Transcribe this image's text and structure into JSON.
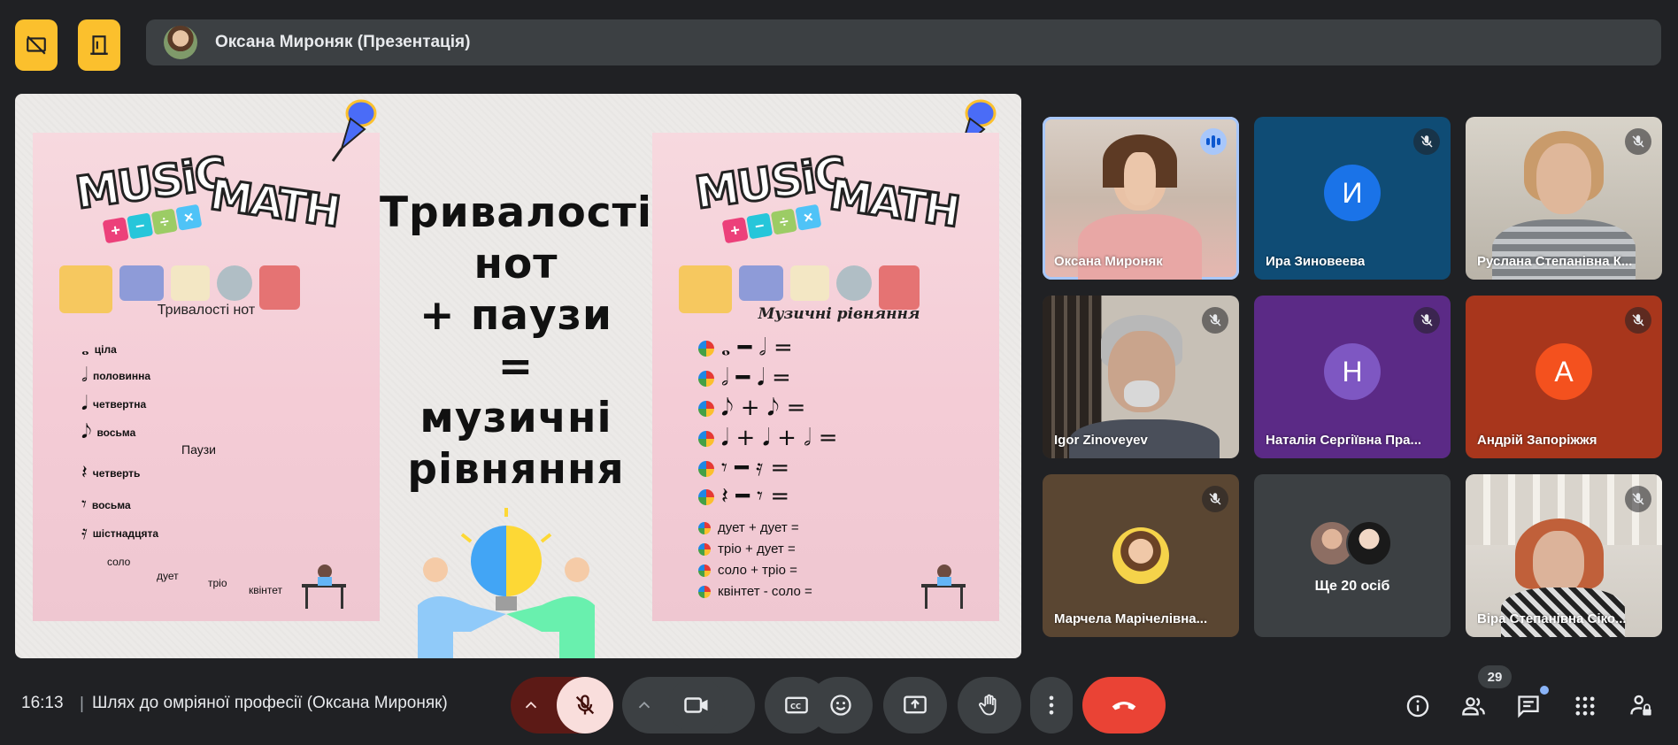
{
  "presenter": {
    "name": "Оксана Мироняк (Презентація)"
  },
  "slide": {
    "left_poster": {
      "word1": "MUSiC",
      "word2": "MATH",
      "title": "Тривалості нот",
      "notes": [
        "ціла",
        "половинна",
        "четвертна",
        "восьма"
      ],
      "pauses_label": "Паузи",
      "rests": [
        "четверть",
        "восьма",
        "шістнадцята"
      ],
      "ensembles": [
        "соло",
        "дует",
        "тріо",
        "квінтет"
      ]
    },
    "center_title": [
      "Тривалості",
      "нот",
      "+ паузи",
      "=",
      "музичні",
      "рівняння"
    ],
    "right_poster": {
      "word1": "MUSiC",
      "word2": "MATH",
      "title": "Музичні рівняння",
      "equations": [
        "𝅝 ━ 𝅗𝅥 =",
        "𝅗𝅥 ━ 𝅘𝅥 =",
        "𝅘𝅥𝅮 + 𝅘𝅥𝅮 =",
        "𝅘𝅥 + 𝅘𝅥 + 𝅗𝅥 =",
        "𝄾 ━ 𝄿 =",
        "𝄽 ━ 𝄾 ="
      ],
      "word_equations": [
        "дует + дует =",
        "тріо + дует =",
        "соло + тріо =",
        "квінтет - соло ="
      ]
    }
  },
  "participants": [
    {
      "name": "Оксана Мироняк",
      "kind": "video",
      "speaking": true
    },
    {
      "name": "Ира Зиновеева",
      "kind": "letter",
      "letter": "И",
      "avatar_color": "#1a73e8",
      "bg": "#0f4c75",
      "muted": true
    },
    {
      "name": "Руслана Степанівна К...",
      "kind": "video",
      "muted": true
    },
    {
      "name": "Igor Zinoveyev",
      "kind": "video",
      "muted": true
    },
    {
      "name": "Наталія Сергіївна Пра...",
      "kind": "letter",
      "letter": "Н",
      "avatar_color": "#7e57c2",
      "bg": "#5b2a86",
      "muted": true
    },
    {
      "name": "Андрій Запоріжжя",
      "kind": "letter",
      "letter": "А",
      "avatar_color": "#f4511e",
      "bg": "#a8361c",
      "muted": true
    },
    {
      "name": "Марчела Марічелівна...",
      "kind": "photo",
      "muted": true
    },
    {
      "name": "Ще 20 осіб",
      "kind": "more"
    },
    {
      "name": "Віра Степанівна Сіко...",
      "kind": "video",
      "muted": true
    }
  ],
  "bottom": {
    "time": "16:13",
    "separator": "|",
    "meeting_title": "Шлях до омріяної професії (Оксана Мироняк)",
    "people_count": "29"
  },
  "colors": {
    "background": "#202124",
    "accent_yellow": "#fbc02d",
    "hangup_red": "#ea4335",
    "mic_off_bg": "#f9dedc"
  },
  "icons": [
    "no-presentation-icon",
    "door-exit-icon",
    "mic-off-icon",
    "chevron-up-icon",
    "camera-icon",
    "captions-icon",
    "emoji-icon",
    "present-icon",
    "raise-hand-icon",
    "more-vert-icon",
    "hangup-icon",
    "info-icon",
    "people-icon",
    "chat-icon",
    "apps-icon",
    "lock-person-icon"
  ]
}
